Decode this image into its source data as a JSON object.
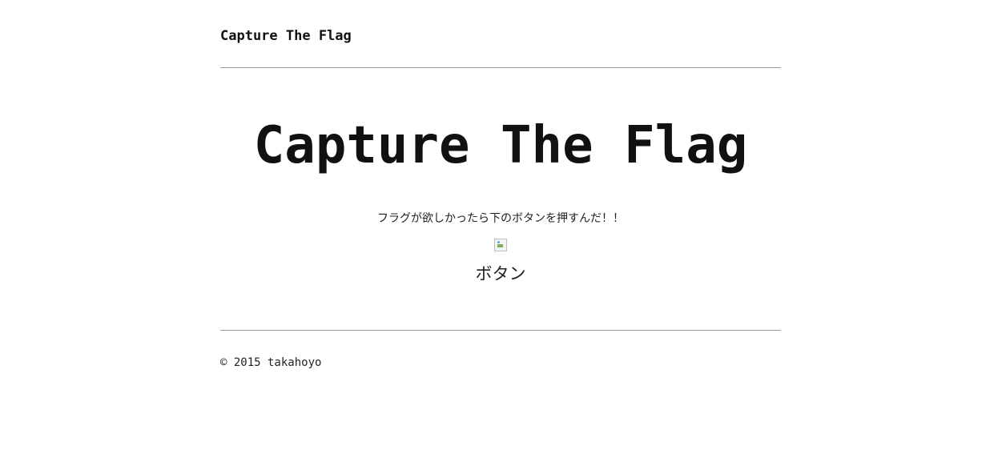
{
  "header": {
    "site_title": "Capture The Flag"
  },
  "main": {
    "title": "Capture The Flag",
    "instruction": "フラグが欲しかったら下のボタンを押すんだ！！",
    "image_icon": "broken-image-icon",
    "button_label": "ボタン"
  },
  "footer": {
    "copyright": "© 2015 takahoyo"
  },
  "colors": {
    "text": "#111111",
    "rule": "#999999",
    "background": "#ffffff"
  }
}
